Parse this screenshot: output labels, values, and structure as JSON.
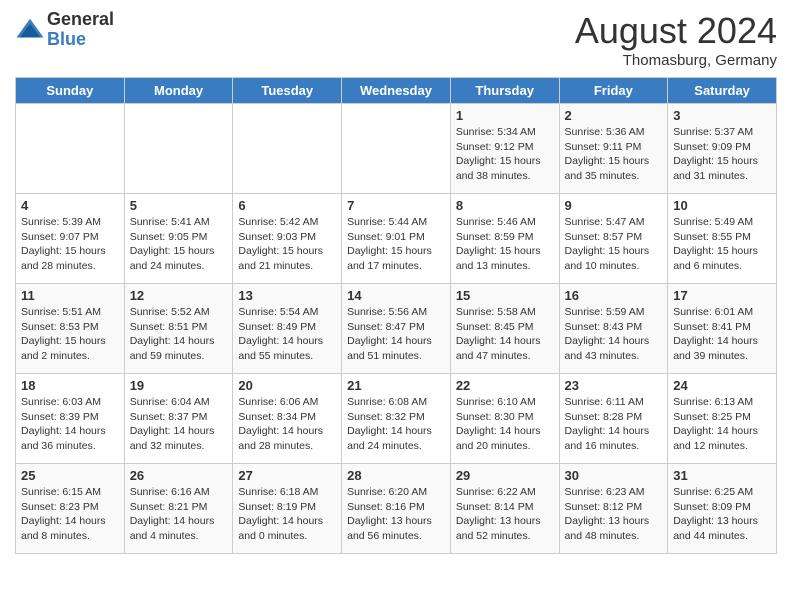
{
  "logo": {
    "general": "General",
    "blue": "Blue"
  },
  "title": "August 2024",
  "subtitle": "Thomasburg, Germany",
  "days_of_week": [
    "Sunday",
    "Monday",
    "Tuesday",
    "Wednesday",
    "Thursday",
    "Friday",
    "Saturday"
  ],
  "weeks": [
    [
      {
        "num": "",
        "info": ""
      },
      {
        "num": "",
        "info": ""
      },
      {
        "num": "",
        "info": ""
      },
      {
        "num": "",
        "info": ""
      },
      {
        "num": "1",
        "info": "Sunrise: 5:34 AM\nSunset: 9:12 PM\nDaylight: 15 hours and 38 minutes."
      },
      {
        "num": "2",
        "info": "Sunrise: 5:36 AM\nSunset: 9:11 PM\nDaylight: 15 hours and 35 minutes."
      },
      {
        "num": "3",
        "info": "Sunrise: 5:37 AM\nSunset: 9:09 PM\nDaylight: 15 hours and 31 minutes."
      }
    ],
    [
      {
        "num": "4",
        "info": "Sunrise: 5:39 AM\nSunset: 9:07 PM\nDaylight: 15 hours and 28 minutes."
      },
      {
        "num": "5",
        "info": "Sunrise: 5:41 AM\nSunset: 9:05 PM\nDaylight: 15 hours and 24 minutes."
      },
      {
        "num": "6",
        "info": "Sunrise: 5:42 AM\nSunset: 9:03 PM\nDaylight: 15 hours and 21 minutes."
      },
      {
        "num": "7",
        "info": "Sunrise: 5:44 AM\nSunset: 9:01 PM\nDaylight: 15 hours and 17 minutes."
      },
      {
        "num": "8",
        "info": "Sunrise: 5:46 AM\nSunset: 8:59 PM\nDaylight: 15 hours and 13 minutes."
      },
      {
        "num": "9",
        "info": "Sunrise: 5:47 AM\nSunset: 8:57 PM\nDaylight: 15 hours and 10 minutes."
      },
      {
        "num": "10",
        "info": "Sunrise: 5:49 AM\nSunset: 8:55 PM\nDaylight: 15 hours and 6 minutes."
      }
    ],
    [
      {
        "num": "11",
        "info": "Sunrise: 5:51 AM\nSunset: 8:53 PM\nDaylight: 15 hours and 2 minutes."
      },
      {
        "num": "12",
        "info": "Sunrise: 5:52 AM\nSunset: 8:51 PM\nDaylight: 14 hours and 59 minutes."
      },
      {
        "num": "13",
        "info": "Sunrise: 5:54 AM\nSunset: 8:49 PM\nDaylight: 14 hours and 55 minutes."
      },
      {
        "num": "14",
        "info": "Sunrise: 5:56 AM\nSunset: 8:47 PM\nDaylight: 14 hours and 51 minutes."
      },
      {
        "num": "15",
        "info": "Sunrise: 5:58 AM\nSunset: 8:45 PM\nDaylight: 14 hours and 47 minutes."
      },
      {
        "num": "16",
        "info": "Sunrise: 5:59 AM\nSunset: 8:43 PM\nDaylight: 14 hours and 43 minutes."
      },
      {
        "num": "17",
        "info": "Sunrise: 6:01 AM\nSunset: 8:41 PM\nDaylight: 14 hours and 39 minutes."
      }
    ],
    [
      {
        "num": "18",
        "info": "Sunrise: 6:03 AM\nSunset: 8:39 PM\nDaylight: 14 hours and 36 minutes."
      },
      {
        "num": "19",
        "info": "Sunrise: 6:04 AM\nSunset: 8:37 PM\nDaylight: 14 hours and 32 minutes."
      },
      {
        "num": "20",
        "info": "Sunrise: 6:06 AM\nSunset: 8:34 PM\nDaylight: 14 hours and 28 minutes."
      },
      {
        "num": "21",
        "info": "Sunrise: 6:08 AM\nSunset: 8:32 PM\nDaylight: 14 hours and 24 minutes."
      },
      {
        "num": "22",
        "info": "Sunrise: 6:10 AM\nSunset: 8:30 PM\nDaylight: 14 hours and 20 minutes."
      },
      {
        "num": "23",
        "info": "Sunrise: 6:11 AM\nSunset: 8:28 PM\nDaylight: 14 hours and 16 minutes."
      },
      {
        "num": "24",
        "info": "Sunrise: 6:13 AM\nSunset: 8:25 PM\nDaylight: 14 hours and 12 minutes."
      }
    ],
    [
      {
        "num": "25",
        "info": "Sunrise: 6:15 AM\nSunset: 8:23 PM\nDaylight: 14 hours and 8 minutes."
      },
      {
        "num": "26",
        "info": "Sunrise: 6:16 AM\nSunset: 8:21 PM\nDaylight: 14 hours and 4 minutes."
      },
      {
        "num": "27",
        "info": "Sunrise: 6:18 AM\nSunset: 8:19 PM\nDaylight: 14 hours and 0 minutes."
      },
      {
        "num": "28",
        "info": "Sunrise: 6:20 AM\nSunset: 8:16 PM\nDaylight: 13 hours and 56 minutes."
      },
      {
        "num": "29",
        "info": "Sunrise: 6:22 AM\nSunset: 8:14 PM\nDaylight: 13 hours and 52 minutes."
      },
      {
        "num": "30",
        "info": "Sunrise: 6:23 AM\nSunset: 8:12 PM\nDaylight: 13 hours and 48 minutes."
      },
      {
        "num": "31",
        "info": "Sunrise: 6:25 AM\nSunset: 8:09 PM\nDaylight: 13 hours and 44 minutes."
      }
    ]
  ]
}
